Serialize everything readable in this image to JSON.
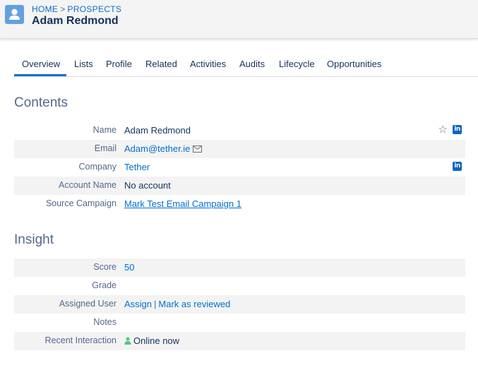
{
  "header": {
    "breadcrumb": [
      "HOME",
      "PROSPECTS"
    ],
    "breadcrumb_separator": ">",
    "title": "Adam Redmond",
    "icon": "person-icon",
    "icon_color": "#62a0e0"
  },
  "tabs": [
    {
      "label": "Overview",
      "active": true
    },
    {
      "label": "Lists"
    },
    {
      "label": "Profile"
    },
    {
      "label": "Related"
    },
    {
      "label": "Activities"
    },
    {
      "label": "Audits"
    },
    {
      "label": "Lifecycle"
    },
    {
      "label": "Opportunities"
    }
  ],
  "contents": {
    "title": "Contents",
    "rows": [
      {
        "label": "Name",
        "value": "Adam Redmond"
      },
      {
        "label": "Email",
        "value": "Adam@tether.ie"
      },
      {
        "label": "Company",
        "value": "Tether"
      },
      {
        "label": "Account Name",
        "value": "No account"
      },
      {
        "label": "Source Campaign",
        "value": "Mark Test Email Campaign 1"
      }
    ]
  },
  "insight": {
    "title": "Insight",
    "rows": [
      {
        "label": "Score",
        "value": "50"
      },
      {
        "label": "Grade",
        "value": ""
      },
      {
        "label": "Assigned User",
        "assign": "Assign",
        "separator": "|",
        "reviewed": "Mark as reviewed"
      },
      {
        "label": "Notes",
        "value": ""
      },
      {
        "label": "Recent Interaction",
        "value": "Online now"
      }
    ]
  },
  "icons": {
    "linkedin": "in",
    "linkedin_color": "#0a66c2",
    "star": "☆",
    "link_color": "#0070d2"
  }
}
